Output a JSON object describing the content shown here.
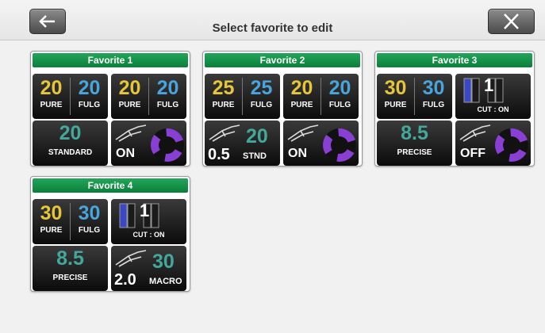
{
  "header": {
    "title": "Select favorite to edit",
    "back_icon": "arrow-left-icon",
    "close_icon": "close-x-icon"
  },
  "colors": {
    "title_green": "#0f8a3c",
    "tile_black": "#111111",
    "pure": "#e6c53a",
    "fulg": "#49a4dc",
    "value_teal": "#43a89a",
    "ring_purple": "#8a3fd4"
  },
  "favorites": [
    {
      "title": "Favorite 1",
      "pf1": {
        "pure": "20",
        "fulg": "20",
        "pure_label": "PURE",
        "fulg_label": "FULG"
      },
      "pf2": {
        "pure": "20",
        "fulg": "20",
        "pure_label": "PURE",
        "fulg_label": "FULG"
      },
      "setting": {
        "value": "20",
        "label": "STANDARD"
      },
      "handpiece": {
        "state": "ON"
      }
    },
    {
      "title": "Favorite 2",
      "pf1": {
        "pure": "25",
        "fulg": "25",
        "pure_label": "PURE",
        "fulg_label": "FULG"
      },
      "pf2": {
        "pure": "20",
        "fulg": "20",
        "pure_label": "PURE",
        "fulg_label": "FULG"
      },
      "cut": {
        "value": "0.5",
        "number": "20",
        "mode": "STND"
      },
      "handpiece": {
        "state": "ON"
      }
    },
    {
      "title": "Favorite 3",
      "pf1": {
        "pure": "30",
        "fulg": "30",
        "pure_label": "PURE",
        "fulg_label": "FULG"
      },
      "bars": {
        "level": "1",
        "label": "CUT : ON"
      },
      "setting": {
        "value": "8.5",
        "label": "PRECISE"
      },
      "handpiece": {
        "state": "OFF"
      }
    },
    {
      "title": "Favorite 4",
      "pf1": {
        "pure": "30",
        "fulg": "30",
        "pure_label": "PURE",
        "fulg_label": "FULG"
      },
      "bars": {
        "level": "1",
        "label": "CUT : ON"
      },
      "setting": {
        "value": "8.5",
        "label": "PRECISE"
      },
      "cut": {
        "value": "2.0",
        "number": "30",
        "mode": "MACRO"
      }
    }
  ]
}
